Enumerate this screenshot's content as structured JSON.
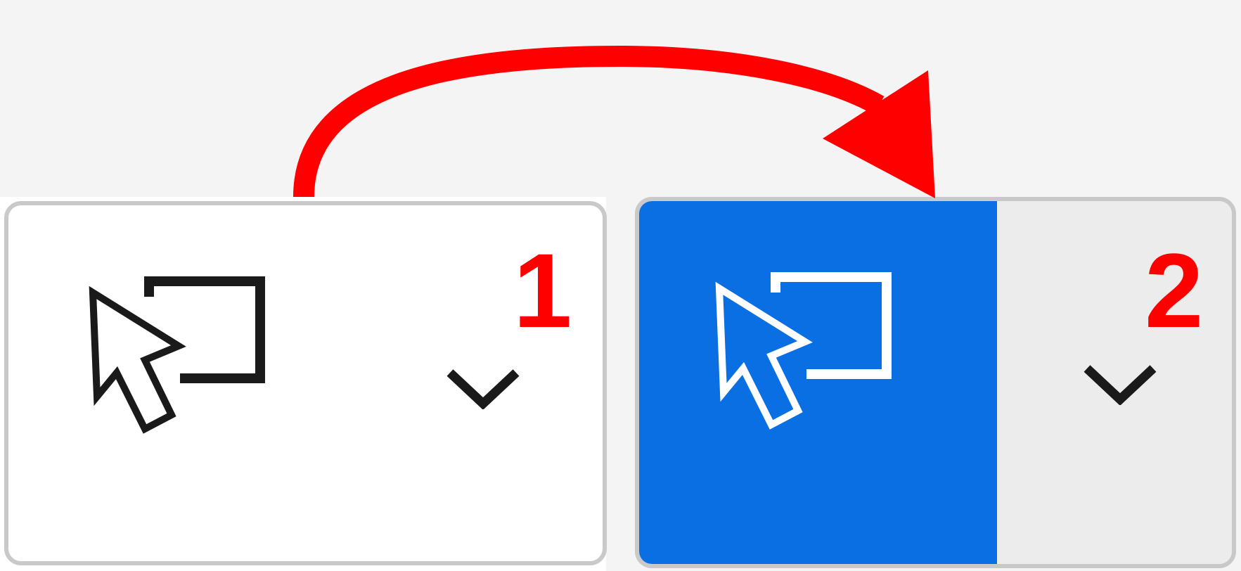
{
  "colors": {
    "background": "#f4f4f4",
    "border": "#c9c9c9",
    "selected_fill": "#0a6fe3",
    "dropdown_fill": "#ececec",
    "annotation": "#ff0000",
    "icon_dark": "#1a1a1a",
    "icon_light": "#ffffff"
  },
  "before": {
    "step_label": "1",
    "icon": "select-region-cursor-icon",
    "dropdown_icon": "chevron-down-icon",
    "state": "unselected"
  },
  "after": {
    "step_label": "2",
    "icon": "select-region-cursor-icon",
    "dropdown_icon": "chevron-down-icon",
    "state": "selected"
  },
  "annotation": {
    "icon": "curved-arrow-icon",
    "meaning": "transition"
  }
}
